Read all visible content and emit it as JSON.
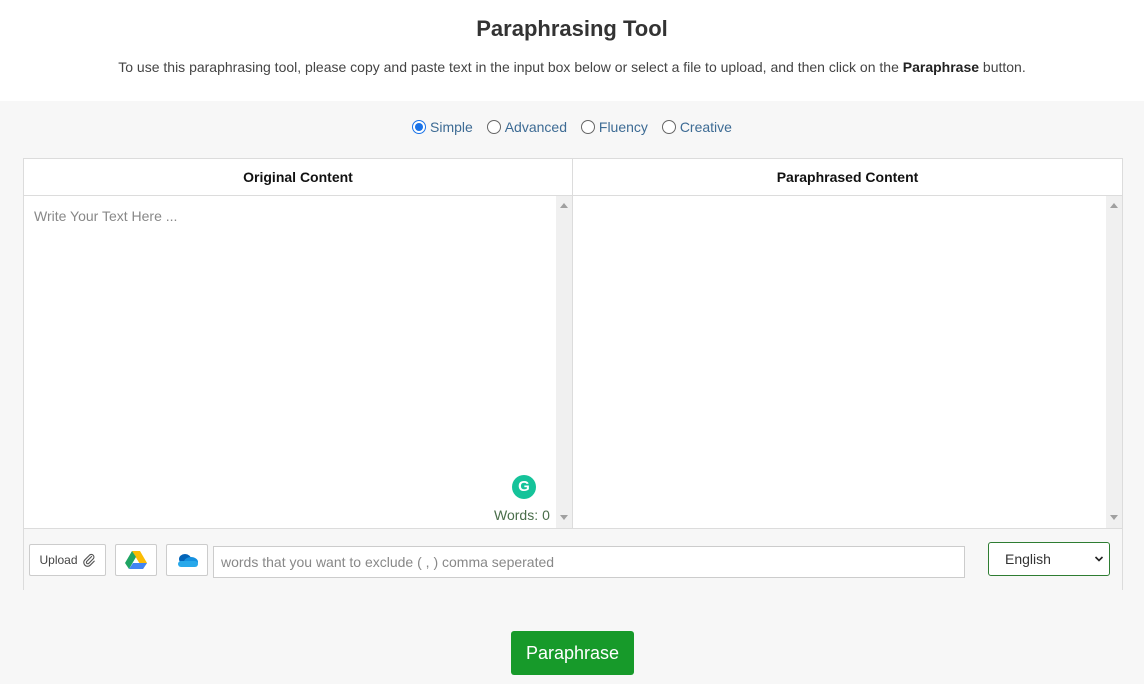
{
  "header": {
    "title": "Paraphrasing Tool",
    "subtitle_before": "To use this paraphrasing tool, please copy and paste text in the input box below or select a file to upload, and then click on the ",
    "subtitle_bold": "Paraphrase",
    "subtitle_after": " button."
  },
  "modes": [
    {
      "label": "Simple",
      "selected": true
    },
    {
      "label": "Advanced",
      "selected": false
    },
    {
      "label": "Fluency",
      "selected": false
    },
    {
      "label": "Creative",
      "selected": false
    }
  ],
  "original": {
    "heading": "Original Content",
    "placeholder": "Write Your Text Here ...",
    "words_label": "Words:",
    "words_count": "0"
  },
  "paraphrased": {
    "heading": "Paraphrased Content"
  },
  "toolbar": {
    "upload_label": "Upload",
    "exclude_placeholder": "words that you want to exclude ( , ) comma seperated",
    "language": "English"
  },
  "actions": {
    "paraphrase_label": "Paraphrase"
  },
  "colors": {
    "accent_green": "#179a2a",
    "radio_blue": "#1a73e8",
    "grammarly": "#15c39a"
  }
}
